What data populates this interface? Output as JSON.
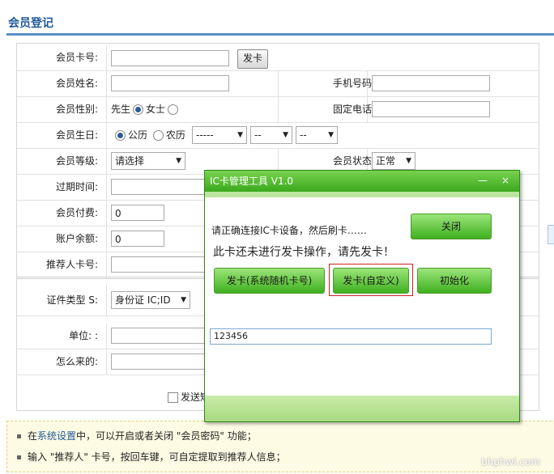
{
  "page": {
    "title": "会员登记"
  },
  "form": {
    "card_no": {
      "label": "会员卡号:",
      "value": "",
      "issue_button": "发卡"
    },
    "name": {
      "label": "会员姓名:",
      "value": ""
    },
    "mobile": {
      "label": "手机号码:",
      "value": ""
    },
    "gender": {
      "label": "会员性别:",
      "option_male": "先生",
      "option_female": "女士",
      "selected": "male"
    },
    "phone": {
      "label": "固定电话:",
      "value": ""
    },
    "birthday": {
      "label": "会员生日:",
      "option_solar": "公历",
      "option_lunar": "农历",
      "selected": "solar",
      "year": "-----",
      "month": "--",
      "day": "--"
    },
    "level": {
      "label": "会员等级:",
      "value": "请选择"
    },
    "status": {
      "label": "会员状态:",
      "value": "正常"
    },
    "expire": {
      "label": "过期时间:",
      "value": ""
    },
    "fee": {
      "label": "会员付费:",
      "value": "0"
    },
    "balance": {
      "label": "账户余额:",
      "value": "0"
    },
    "referrer": {
      "label": "推荐人卡号:",
      "value": ""
    },
    "id_type": {
      "label": "证件类型 S:",
      "value": "身份证 IC;ID"
    },
    "company": {
      "label": "单位: :",
      "value": ""
    },
    "source": {
      "label": "怎么来的:",
      "value": ""
    },
    "send_checkbox_label": "发送短"
  },
  "tips": [
    {
      "prefix": "在",
      "link": "系统设置",
      "suffix": "中，可以开启或者关闭 \"会员密码\" 功能；"
    },
    {
      "prefix": "输入 \"推荐人\" 卡号，按回车键，可自定提取到推荐人信息；",
      "link": "",
      "suffix": ""
    }
  ],
  "dialog": {
    "title": "IC卡管理工具 V1.0",
    "minimize_glyph": "—",
    "close_glyph": "×",
    "message1": "请正确连接IC卡设备，然后刷卡……",
    "message2": "此卡还未进行发卡操作，请先发卡！",
    "close_button": "关闭",
    "issue_random_button": "发卡(系统随机卡号)",
    "issue_custom_button": "发卡(自定义)",
    "init_button": "初始化",
    "card_input": "123456"
  },
  "watermark": "bhphwl.com",
  "colors": {
    "title_blue": "#1f5a99",
    "dialog_green": "#3aa91c",
    "focus_red": "#cc2222",
    "tips_bg": "#fdfbe3"
  }
}
